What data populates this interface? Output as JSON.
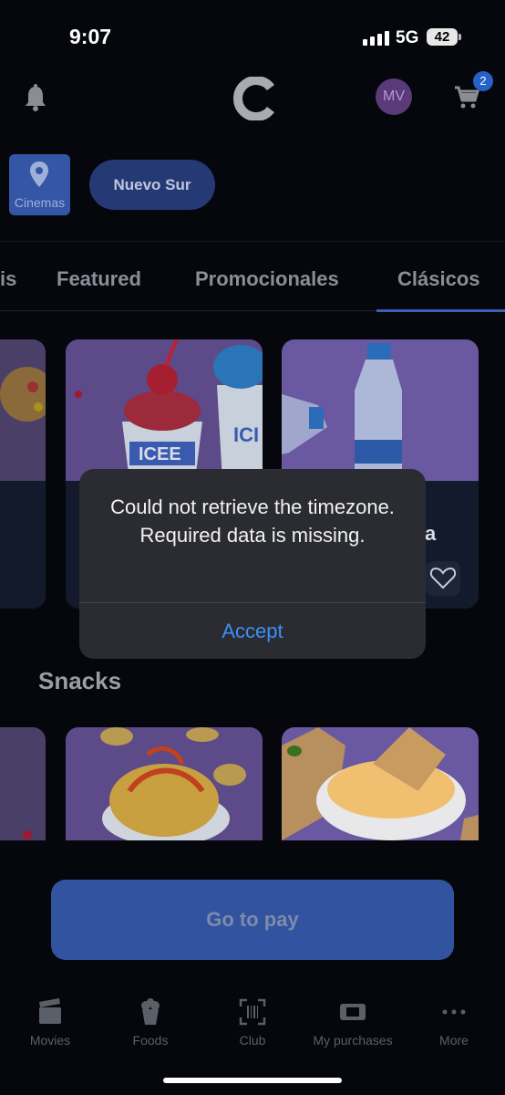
{
  "status_bar": {
    "time": "9:07",
    "network": "5G",
    "battery": "42"
  },
  "header": {
    "avatar_initials": "MV",
    "cart_count": "2"
  },
  "location": {
    "cinemas_label": "Cinemas",
    "selected_cinema": "Nuevo Sur"
  },
  "tabs": [
    {
      "label": "is"
    },
    {
      "label": "Featured"
    },
    {
      "label": "Promocionales"
    },
    {
      "label": "Clásicos",
      "active": true
    }
  ],
  "featured_row": {
    "partial_title": "a"
  },
  "sections": {
    "snacks_title": "Snacks"
  },
  "pay_button": {
    "label": "Go to pay"
  },
  "bottom_nav": [
    {
      "label": "Movies",
      "icon": "clapperboard-icon"
    },
    {
      "label": "Foods",
      "icon": "popcorn-icon"
    },
    {
      "label": "Club",
      "icon": "barcode-scan-icon"
    },
    {
      "label": "My purchases",
      "icon": "ticket-icon"
    },
    {
      "label": "More",
      "icon": "more-dots-icon"
    }
  ],
  "dialog": {
    "message": "Could not retrieve the timezone. Required data is missing.",
    "accept_label": "Accept"
  },
  "colors": {
    "accent": "#3a5fb3",
    "dialog_button": "#3d8ef6",
    "avatar": "#5a3a78"
  }
}
